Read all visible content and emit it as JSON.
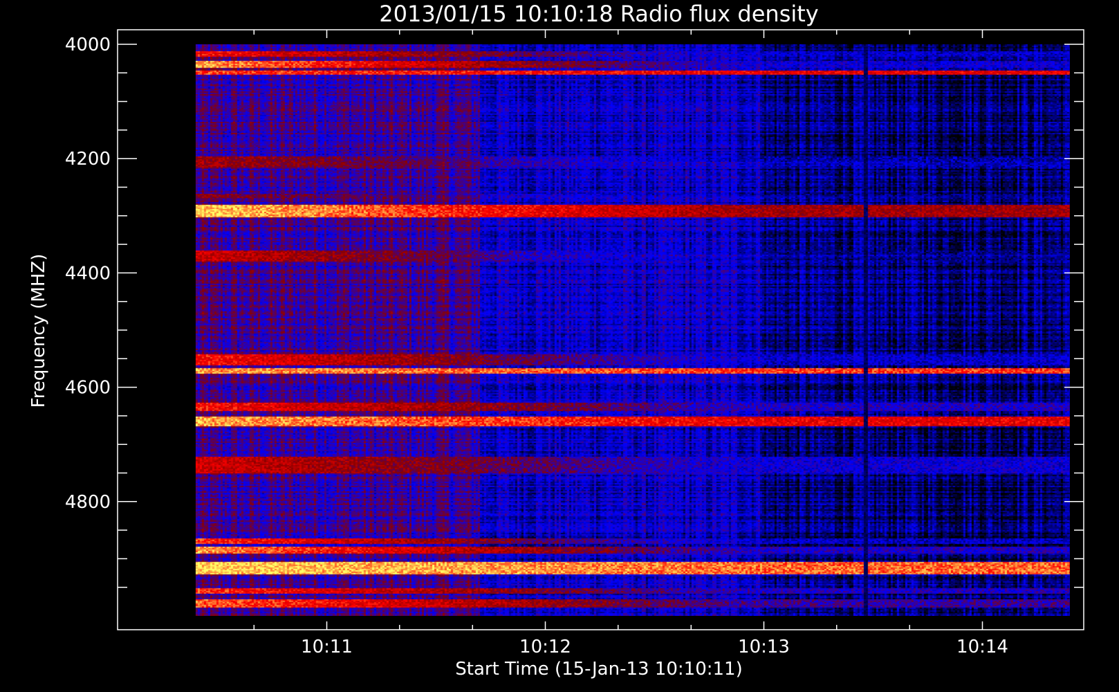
{
  "chart_data": {
    "type": "heatmap",
    "title": "2013/01/15 10:10:18 Radio flux density",
    "xlabel": "Start Time (15-Jan-13 10:10:11)",
    "ylabel": "Frequency (MHZ)",
    "x_unit": "minutes after 10:10:00",
    "xlim": [
      0.2,
      4.33
    ],
    "ylim": [
      4000,
      5000
    ],
    "y_inverted": true,
    "data_xlim": [
      0.4,
      4.4
    ],
    "data_ylim": [
      4000,
      5000
    ],
    "x_major_ticks": [
      {
        "value": 1,
        "label": "10:11"
      },
      {
        "value": 2,
        "label": "10:12"
      },
      {
        "value": 3,
        "label": "10:13"
      },
      {
        "value": 4,
        "label": "10:14"
      }
    ],
    "x_minor_ticks": [
      0.667,
      1.333,
      1.667,
      2.333,
      2.667,
      3.333,
      3.667
    ],
    "y_major_ticks": [
      {
        "value": 4000,
        "label": "4000"
      },
      {
        "value": 4200,
        "label": "4200"
      },
      {
        "value": 4400,
        "label": "4400"
      },
      {
        "value": 4600,
        "label": "4600"
      },
      {
        "value": 4800,
        "label": "4800"
      }
    ],
    "y_minor_ticks": [
      4050,
      4100,
      4150,
      4250,
      4300,
      4350,
      4450,
      4500,
      4550,
      4650,
      4700,
      4750,
      4850,
      4900,
      4950
    ],
    "colormap": [
      "#000000",
      "#0000ff",
      "#8b0000",
      "#ff0000",
      "#ffff66"
    ],
    "background_color": "#000000",
    "axis_color": "#ffffff",
    "time_segments": [
      {
        "x_start": 0.4,
        "x_end": 1.7,
        "base_level": 0.35
      },
      {
        "x_start": 1.7,
        "x_end": 3.0,
        "base_level": 0.22
      },
      {
        "x_start": 3.0,
        "x_end": 4.4,
        "base_level": 0.12
      }
    ],
    "emission_bands": [
      {
        "freq_start": 4010,
        "freq_end": 4020,
        "early_intensity": 0.75,
        "late_intensity": 0.2
      },
      {
        "freq_start": 4028,
        "freq_end": 4040,
        "early_intensity": 0.92,
        "late_intensity": 0.25
      },
      {
        "freq_start": 4046,
        "freq_end": 4052,
        "early_intensity": 0.8,
        "late_intensity": 0.7
      },
      {
        "freq_start": 4195,
        "freq_end": 4215,
        "early_intensity": 0.55,
        "late_intensity": 0.15
      },
      {
        "freq_start": 4260,
        "freq_end": 4268,
        "early_intensity": 0.5,
        "late_intensity": 0.1
      },
      {
        "freq_start": 4280,
        "freq_end": 4302,
        "early_intensity": 0.97,
        "late_intensity": 0.55
      },
      {
        "freq_start": 4360,
        "freq_end": 4378,
        "early_intensity": 0.65,
        "late_intensity": 0.1
      },
      {
        "freq_start": 4540,
        "freq_end": 4560,
        "early_intensity": 0.75,
        "late_intensity": 0.2
      },
      {
        "freq_start": 4565,
        "freq_end": 4575,
        "early_intensity": 0.9,
        "late_intensity": 0.8
      },
      {
        "freq_start": 4625,
        "freq_end": 4640,
        "early_intensity": 0.75,
        "late_intensity": 0.3
      },
      {
        "freq_start": 4650,
        "freq_end": 4668,
        "early_intensity": 0.92,
        "late_intensity": 0.7
      },
      {
        "freq_start": 4720,
        "freq_end": 4750,
        "early_intensity": 0.65,
        "late_intensity": 0.25
      },
      {
        "freq_start": 4862,
        "freq_end": 4872,
        "early_intensity": 0.8,
        "late_intensity": 0.2
      },
      {
        "freq_start": 4878,
        "freq_end": 4890,
        "early_intensity": 0.9,
        "late_intensity": 0.3
      },
      {
        "freq_start": 4905,
        "freq_end": 4925,
        "early_intensity": 0.97,
        "late_intensity": 0.85
      },
      {
        "freq_start": 4950,
        "freq_end": 4960,
        "early_intensity": 0.8,
        "late_intensity": 0.3
      },
      {
        "freq_start": 4970,
        "freq_end": 4985,
        "early_intensity": 0.85,
        "late_intensity": 0.35
      }
    ],
    "vertical_features": [
      {
        "x": 3.46,
        "intensity": 0.05
      }
    ],
    "grid": false,
    "legend": "none"
  }
}
